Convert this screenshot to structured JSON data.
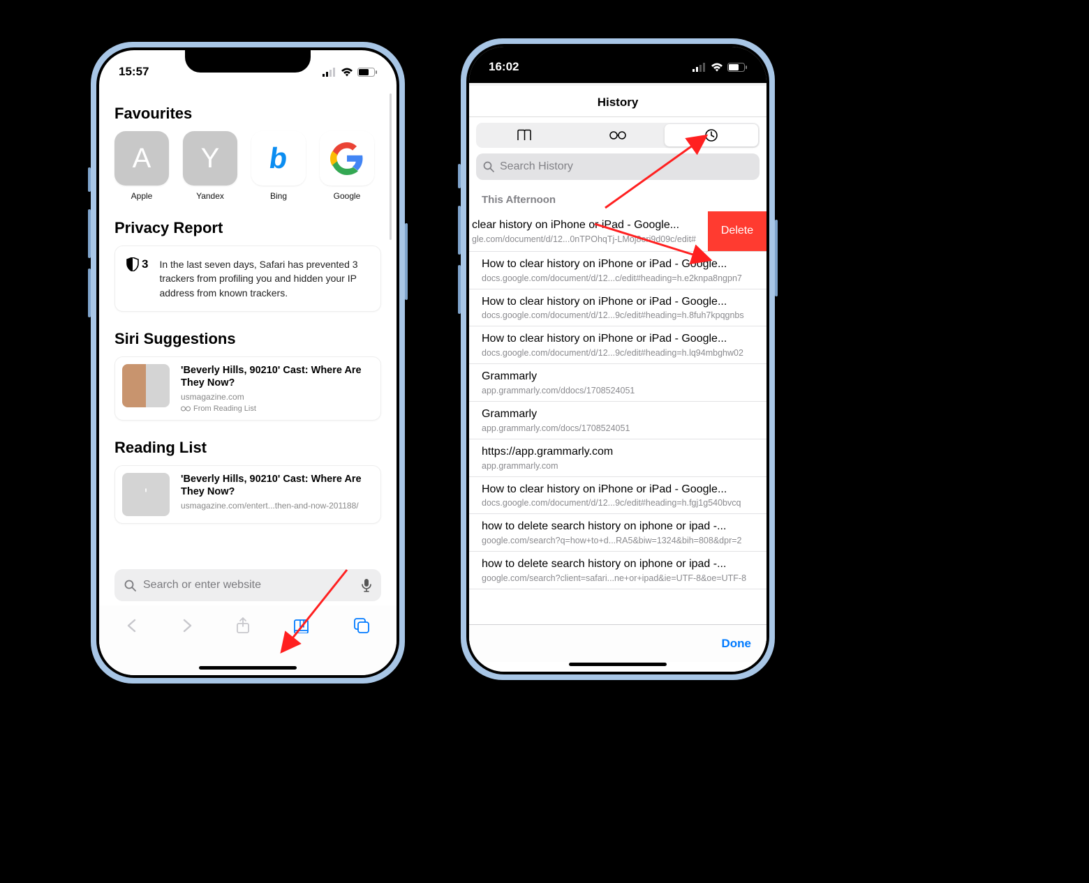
{
  "left": {
    "time": "15:57",
    "favourites_title": "Favourites",
    "favs": [
      {
        "label": "Apple",
        "glyph": "A"
      },
      {
        "label": "Yandex",
        "glyph": "Y"
      },
      {
        "label": "Bing",
        "glyph": "b"
      },
      {
        "label": "Google",
        "glyph": "G"
      }
    ],
    "privacy_title": "Privacy Report",
    "privacy_count": "3",
    "privacy_text": "In the last seven days, Safari has prevented 3 trackers from profiling you and hidden your IP address from known trackers.",
    "siri_title": "Siri Suggestions",
    "siri_item": {
      "title": "'Beverly Hills, 90210' Cast: Where Are They Now?",
      "source": "usmagazine.com",
      "reading": "From Reading List"
    },
    "reading_title": "Reading List",
    "reading_item": {
      "title": "'Beverly Hills, 90210' Cast: Where Are They Now?",
      "url": "usmagazine.com/entert...then-and-now-201188/"
    },
    "search_placeholder": "Search or enter website"
  },
  "right": {
    "time": "16:02",
    "header": "History",
    "search_placeholder": "Search History",
    "group_label": "This Afternoon",
    "delete_label": "Delete",
    "done_label": "Done",
    "rows": [
      {
        "title": "clear history on iPhone or iPad - Google...",
        "url": "gle.com/document/d/12...0nTPOhqTj-LMoj8eri9d09c/edit#",
        "swiped": true
      },
      {
        "title": "How to clear history on iPhone or iPad - Google...",
        "url": "docs.google.com/document/d/12...c/edit#heading=h.e2knpa8ngpn7"
      },
      {
        "title": "How to clear history on iPhone or iPad - Google...",
        "url": "docs.google.com/document/d/12...9c/edit#heading=h.8fuh7kpqgnbs"
      },
      {
        "title": "How to clear history on iPhone or iPad - Google...",
        "url": "docs.google.com/document/d/12...9c/edit#heading=h.lq94mbghw02"
      },
      {
        "title": "Grammarly",
        "url": "app.grammarly.com/ddocs/1708524051"
      },
      {
        "title": "Grammarly",
        "url": "app.grammarly.com/docs/1708524051"
      },
      {
        "title": "https://app.grammarly.com",
        "url": "app.grammarly.com"
      },
      {
        "title": "How to clear history on iPhone or iPad - Google...",
        "url": "docs.google.com/document/d/12...9c/edit#heading=h.fgj1g540bvcq"
      },
      {
        "title": "how to delete search history on iphone or ipad -...",
        "url": "google.com/search?q=how+to+d...RA5&biw=1324&bih=808&dpr=2"
      },
      {
        "title": "how to delete search history on iphone or ipad -...",
        "url": "google.com/search?client=safari...ne+or+ipad&ie=UTF-8&oe=UTF-8"
      }
    ]
  }
}
